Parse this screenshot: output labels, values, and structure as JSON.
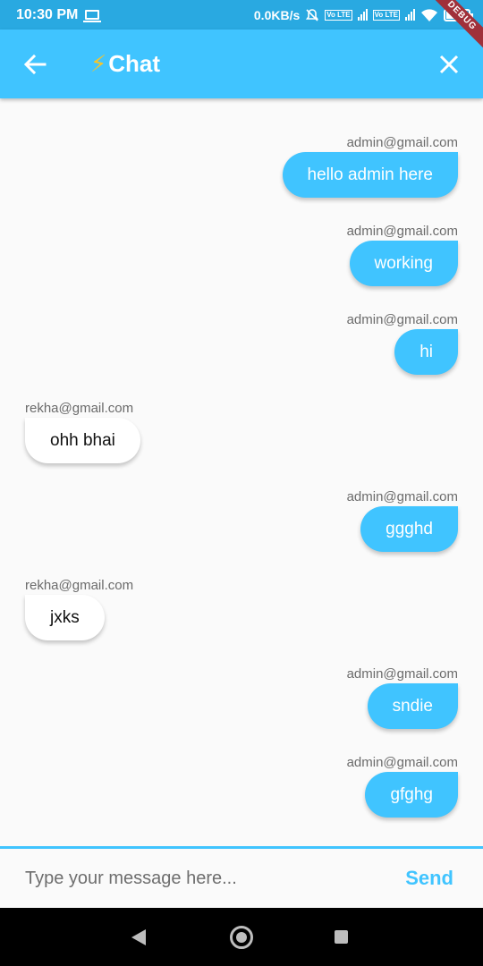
{
  "status_bar": {
    "time": "10:30 PM",
    "network_speed": "0.0KB/s",
    "icons": [
      "laptop-icon",
      "mute-icon",
      "volte-icon",
      "signal-icon",
      "wifi-icon",
      "battery-icon"
    ],
    "volte_label": "Vo LTE"
  },
  "debug_banner": "DEBUG",
  "app_bar": {
    "back_icon": "arrow-back-icon",
    "title_emoji": "⚡",
    "title": "Chat",
    "close_icon": "close-icon",
    "color": "#40c4ff"
  },
  "messages": [
    {
      "sender": "admin@gmail.com",
      "text": "hello admin here",
      "mine": true
    },
    {
      "sender": "admin@gmail.com",
      "text": "working",
      "mine": true
    },
    {
      "sender": "admin@gmail.com",
      "text": "hi",
      "mine": true
    },
    {
      "sender": "rekha@gmail.com",
      "text": "ohh bhai",
      "mine": false
    },
    {
      "sender": "admin@gmail.com",
      "text": "ggghd",
      "mine": true
    },
    {
      "sender": "rekha@gmail.com",
      "text": "jxks",
      "mine": false
    },
    {
      "sender": "admin@gmail.com",
      "text": "sndie",
      "mine": true
    },
    {
      "sender": "admin@gmail.com",
      "text": "gfghg",
      "mine": true
    }
  ],
  "composer": {
    "placeholder": "Type your message here...",
    "value": "",
    "send_label": "Send"
  },
  "nav_bar": {
    "icons": [
      "nav-back-icon",
      "nav-home-icon",
      "nav-recents-icon"
    ]
  }
}
